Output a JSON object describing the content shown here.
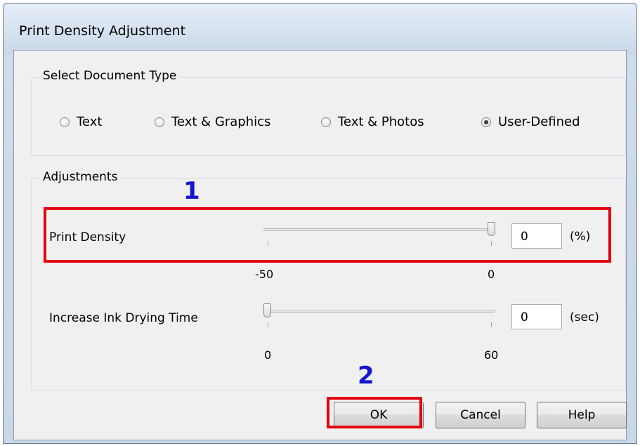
{
  "window": {
    "title": "Print Density Adjustment"
  },
  "document_type": {
    "group_label": "Select Document Type",
    "options": [
      {
        "label": "Text",
        "selected": false
      },
      {
        "label": "Text & Graphics",
        "selected": false
      },
      {
        "label": "Text & Photos",
        "selected": false
      },
      {
        "label": "User-Defined",
        "selected": true
      }
    ]
  },
  "adjustments": {
    "group_label": "Adjustments",
    "print_density": {
      "label": "Print Density",
      "value": "0",
      "unit": "(%)",
      "min_label": "-50",
      "max_label": "0"
    },
    "ink_drying": {
      "label": "Increase Ink Drying Time",
      "value": "0",
      "unit": "(sec)",
      "min_label": "0",
      "max_label": "60"
    }
  },
  "buttons": {
    "ok": "OK",
    "cancel": "Cancel",
    "help": "Help"
  },
  "annotations": {
    "step1": "1",
    "step2": "2",
    "highlight_color": "#e3000f",
    "number_color": "#1414d2"
  }
}
